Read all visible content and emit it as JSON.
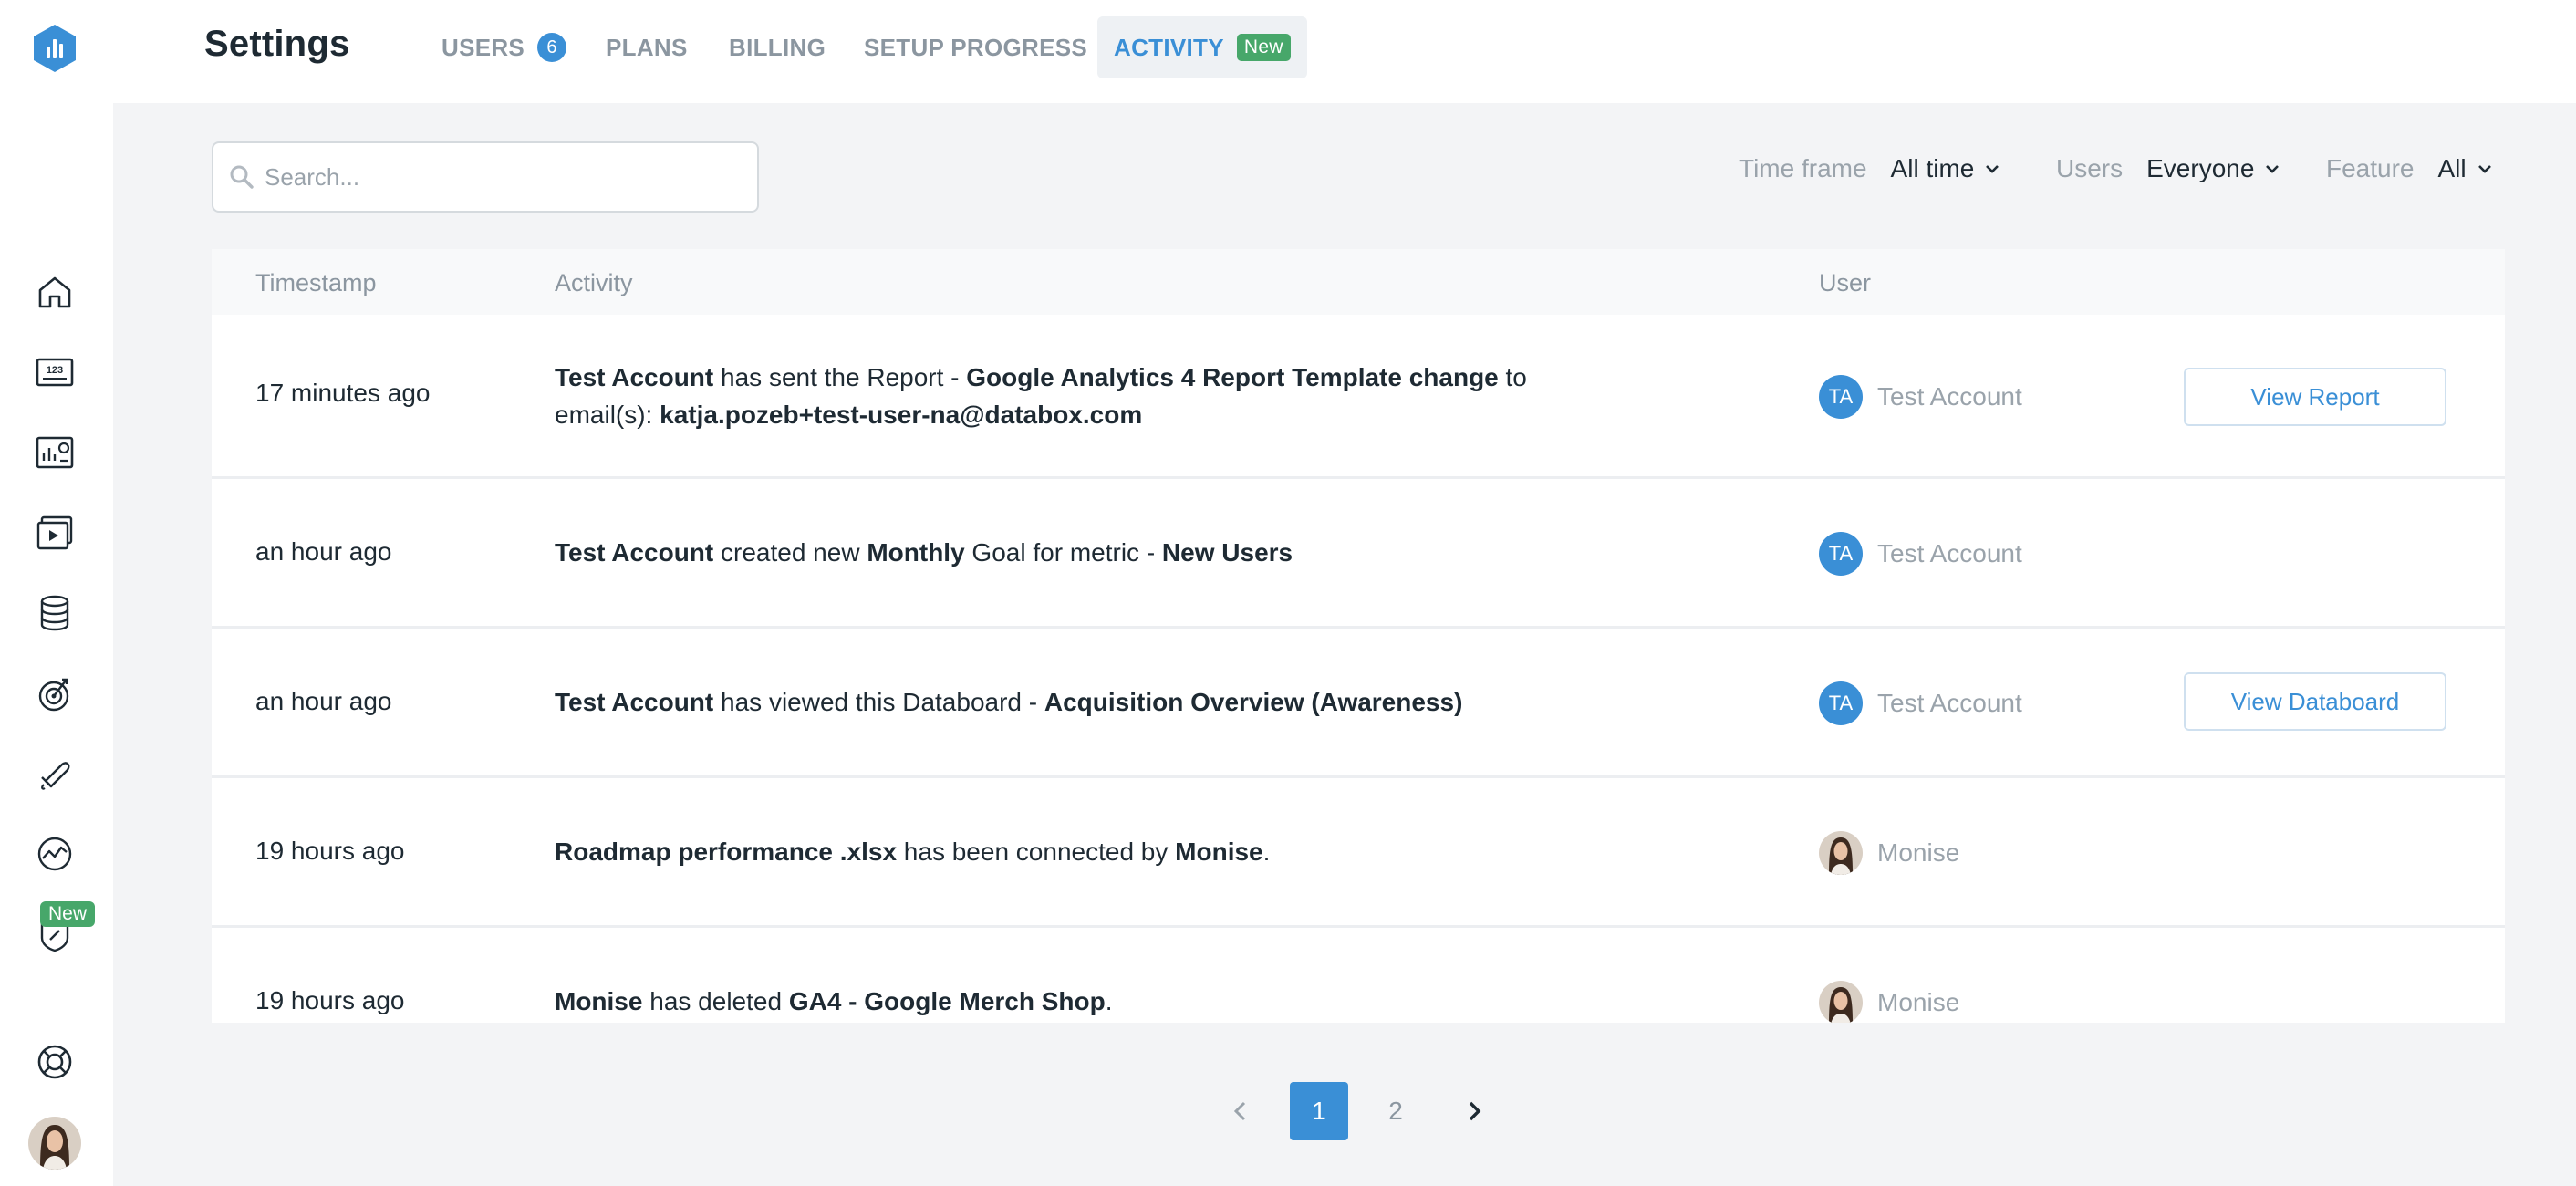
{
  "brand": {
    "accent": "#3a8fd6",
    "new_badge": "#47a76a"
  },
  "rail": {
    "items": [
      {
        "name": "home-icon"
      },
      {
        "name": "metrics-icon",
        "text": "123"
      },
      {
        "name": "databoards-icon"
      },
      {
        "name": "reports-icon"
      },
      {
        "name": "data-sources-icon"
      },
      {
        "name": "goals-icon"
      },
      {
        "name": "alerts-icon"
      },
      {
        "name": "insights-icon"
      },
      {
        "name": "benchmarks-icon"
      }
    ],
    "new_label": "New",
    "help": "help-icon",
    "avatar": "user-avatar"
  },
  "header": {
    "title": "Settings",
    "tabs": [
      {
        "label": "USERS",
        "count": "6"
      },
      {
        "label": "PLANS"
      },
      {
        "label": "BILLING"
      },
      {
        "label": "SETUP PROGRESS"
      },
      {
        "label": "ACTIVITY",
        "badge": "New",
        "active": true
      }
    ]
  },
  "filters": {
    "search_placeholder": "Search...",
    "timeframe": {
      "label": "Time frame",
      "value": "All time"
    },
    "users": {
      "label": "Users",
      "value": "Everyone"
    },
    "feature": {
      "label": "Feature",
      "value": "All"
    }
  },
  "table": {
    "columns": {
      "timestamp": "Timestamp",
      "activity": "Activity",
      "user": "User"
    },
    "rows": [
      {
        "time": "17 minutes ago",
        "a1": "Test Account",
        "a2": " has sent the Report - ",
        "a3": "Google Analytics 4 Report Template change",
        "a4": " to email(s): ",
        "a5": "katja.pozeb+test-user-na@databox.com",
        "user_initials": "TA",
        "user": "Test Account",
        "button": "View Report"
      },
      {
        "time": "an hour ago",
        "a1": "Test Account",
        "a2": " created new ",
        "a3": "Monthly",
        "a4": " Goal for metric - ",
        "a5": "New Users",
        "user_initials": "TA",
        "user": "Test Account"
      },
      {
        "time": "an hour ago",
        "a1": "Test Account",
        "a2": " has viewed this Databoard - ",
        "a3": "Acquisition Overview (Awareness)",
        "user_initials": "TA",
        "user": "Test Account",
        "button": "View Databoard"
      },
      {
        "time": "19 hours ago",
        "a1": "Roadmap performance .xlsx",
        "a2": " has been connected by ",
        "a3": "Monise",
        "a4": ".",
        "user": "Monise"
      },
      {
        "time": "19 hours ago",
        "a1": "Monise",
        "a2": " has deleted ",
        "a3": "GA4 - Google Merch Shop",
        "a4": ".",
        "user": "Monise"
      }
    ]
  },
  "pagination": {
    "pages": [
      "1",
      "2"
    ],
    "current": "1"
  }
}
